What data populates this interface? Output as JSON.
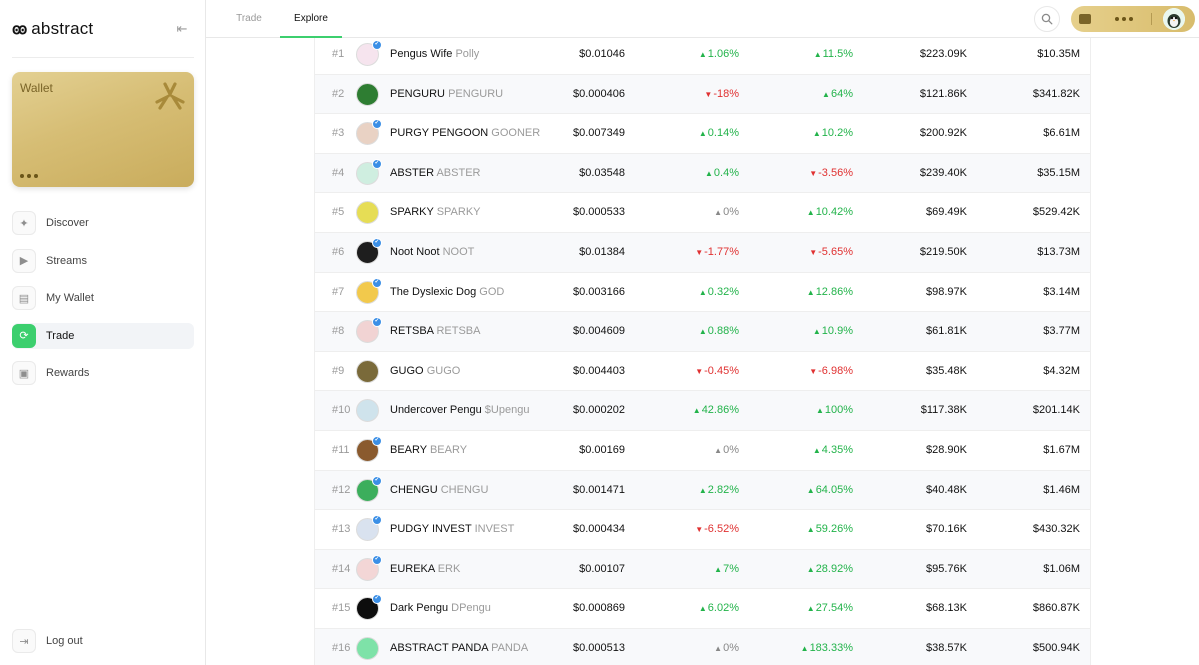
{
  "app": {
    "brand_mark": "ꙭ",
    "brand_name": "abstract"
  },
  "sidebar": {
    "collapse_icon": "collapse-icon",
    "wallet_card": {
      "title": "Wallet"
    },
    "nav": [
      {
        "label": "Discover",
        "icon": "discover-icon",
        "active": false
      },
      {
        "label": "Streams",
        "icon": "play-icon",
        "active": false
      },
      {
        "label": "My Wallet",
        "icon": "wallet-icon",
        "active": false
      },
      {
        "label": "Trade",
        "icon": "swap-icon",
        "active": true
      },
      {
        "label": "Rewards",
        "icon": "gift-icon",
        "active": false
      }
    ],
    "logout_label": "Log out"
  },
  "topbar": {
    "tabs": [
      {
        "label": "Trade",
        "active": false
      },
      {
        "label": "Explore",
        "active": true
      }
    ]
  },
  "colors": {
    "accent": "#3ccf6e",
    "up": "#22b34a",
    "down": "#e03131",
    "gold": "#d6bd74"
  },
  "tokens": [
    {
      "rank": "#1",
      "name": "Pengus Wife",
      "ticker": "Polly",
      "price": "$0.01046",
      "change1": "1.06%",
      "dir1": "up",
      "change2": "11.5%",
      "dir2": "up",
      "volume": "$223.09K",
      "mcap": "$10.35M",
      "verified": true,
      "color": "#f6e4ee"
    },
    {
      "rank": "#2",
      "name": "PENGURU",
      "ticker": "PENGURU",
      "price": "$0.000406",
      "change1": "-18%",
      "dir1": "down",
      "change2": "64%",
      "dir2": "up",
      "volume": "$121.86K",
      "mcap": "$341.82K",
      "verified": false,
      "color": "#2e7d32"
    },
    {
      "rank": "#3",
      "name": "PURGY PENGOON",
      "ticker": "GOONER",
      "price": "$0.007349",
      "change1": "0.14%",
      "dir1": "up",
      "change2": "10.2%",
      "dir2": "up",
      "volume": "$200.92K",
      "mcap": "$6.61M",
      "verified": true,
      "color": "#e9d2c4"
    },
    {
      "rank": "#4",
      "name": "ABSTER",
      "ticker": "ABSTER",
      "price": "$0.03548",
      "change1": "0.4%",
      "dir1": "up",
      "change2": "-3.56%",
      "dir2": "down",
      "volume": "$239.40K",
      "mcap": "$35.15M",
      "verified": true,
      "color": "#cfeee0"
    },
    {
      "rank": "#5",
      "name": "SPARKY",
      "ticker": "SPARKY",
      "price": "$0.000533",
      "change1": "0%",
      "dir1": "flat",
      "change2": "10.42%",
      "dir2": "up",
      "volume": "$69.49K",
      "mcap": "$529.42K",
      "verified": false,
      "color": "#e6dd55"
    },
    {
      "rank": "#6",
      "name": "Noot Noot",
      "ticker": "NOOT",
      "price": "$0.01384",
      "change1": "-1.77%",
      "dir1": "down",
      "change2": "-5.65%",
      "dir2": "down",
      "volume": "$219.50K",
      "mcap": "$13.73M",
      "verified": true,
      "color": "#1e1e1e"
    },
    {
      "rank": "#7",
      "name": "The Dyslexic Dog",
      "ticker": "GOD",
      "price": "$0.003166",
      "change1": "0.32%",
      "dir1": "up",
      "change2": "12.86%",
      "dir2": "up",
      "volume": "$98.97K",
      "mcap": "$3.14M",
      "verified": true,
      "color": "#f2c94c"
    },
    {
      "rank": "#8",
      "name": "RETSBA",
      "ticker": "RETSBA",
      "price": "$0.004609",
      "change1": "0.88%",
      "dir1": "up",
      "change2": "10.9%",
      "dir2": "up",
      "volume": "$61.81K",
      "mcap": "$3.77M",
      "verified": true,
      "color": "#f1d3d3"
    },
    {
      "rank": "#9",
      "name": "GUGO",
      "ticker": "GUGO",
      "price": "$0.004403",
      "change1": "-0.45%",
      "dir1": "down",
      "change2": "-6.98%",
      "dir2": "down",
      "volume": "$35.48K",
      "mcap": "$4.32M",
      "verified": false,
      "color": "#7a6a3a"
    },
    {
      "rank": "#10",
      "name": "Undercover Pengu",
      "ticker": "$Upengu",
      "price": "$0.000202",
      "change1": "42.86%",
      "dir1": "up",
      "change2": "100%",
      "dir2": "up",
      "volume": "$117.38K",
      "mcap": "$201.14K",
      "verified": false,
      "color": "#cfe3ec"
    },
    {
      "rank": "#11",
      "name": "BEARY",
      "ticker": "BEARY",
      "price": "$0.00169",
      "change1": "0%",
      "dir1": "flat",
      "change2": "4.35%",
      "dir2": "up",
      "volume": "$28.90K",
      "mcap": "$1.67M",
      "verified": true,
      "color": "#8a5a2e"
    },
    {
      "rank": "#12",
      "name": "CHENGU",
      "ticker": "CHENGU",
      "price": "$0.001471",
      "change1": "2.82%",
      "dir1": "up",
      "change2": "64.05%",
      "dir2": "up",
      "volume": "$40.48K",
      "mcap": "$1.46M",
      "verified": true,
      "color": "#3cae5c"
    },
    {
      "rank": "#13",
      "name": "PUDGY INVEST",
      "ticker": "INVEST",
      "price": "$0.000434",
      "change1": "-6.52%",
      "dir1": "down",
      "change2": "59.26%",
      "dir2": "up",
      "volume": "$70.16K",
      "mcap": "$430.32K",
      "verified": true,
      "color": "#d9e2ef"
    },
    {
      "rank": "#14",
      "name": "EUREKA",
      "ticker": "ERK",
      "price": "$0.00107",
      "change1": "7%",
      "dir1": "up",
      "change2": "28.92%",
      "dir2": "up",
      "volume": "$95.76K",
      "mcap": "$1.06M",
      "verified": true,
      "color": "#f3d6d6"
    },
    {
      "rank": "#15",
      "name": "Dark Pengu",
      "ticker": "DPengu",
      "price": "$0.000869",
      "change1": "6.02%",
      "dir1": "up",
      "change2": "27.54%",
      "dir2": "up",
      "volume": "$68.13K",
      "mcap": "$860.87K",
      "verified": true,
      "color": "#0d0d0d"
    },
    {
      "rank": "#16",
      "name": "ABSTRACT PANDA",
      "ticker": "PANDA",
      "price": "$0.000513",
      "change1": "0%",
      "dir1": "flat",
      "change2": "183.33%",
      "dir2": "up",
      "volume": "$38.57K",
      "mcap": "$500.94K",
      "verified": false,
      "color": "#7ee2a8"
    }
  ]
}
